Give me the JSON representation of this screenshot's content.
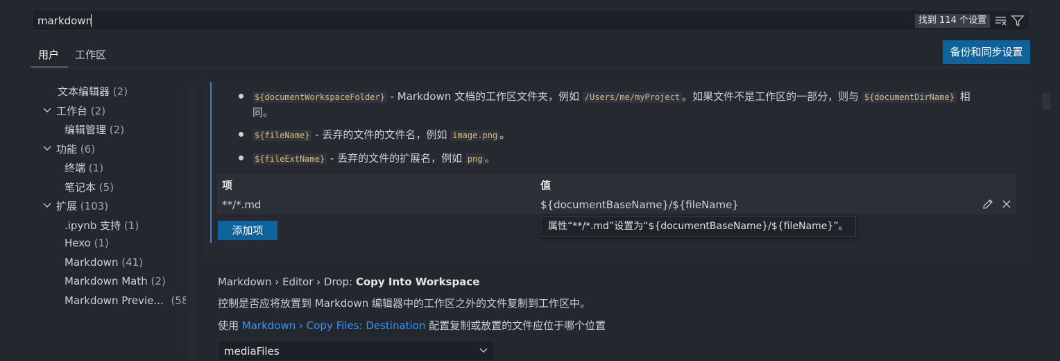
{
  "search": {
    "value": "markdown",
    "result_count": "找到 114 个设置"
  },
  "tabs": {
    "user": "用户",
    "workspace": "工作区"
  },
  "sync_button": "备份和同步设置",
  "sidebar": {
    "items": [
      {
        "label": "文本编辑器",
        "count": "(2)"
      },
      {
        "label": "工作台",
        "count": "(2)"
      },
      {
        "label": "编辑管理",
        "count": "(2)"
      },
      {
        "label": "功能",
        "count": "(6)"
      },
      {
        "label": "终端",
        "count": "(1)"
      },
      {
        "label": "笔记本",
        "count": "(5)"
      },
      {
        "label": "扩展",
        "count": "(103)"
      },
      {
        "label": ".ipynb 支持",
        "count": "(1)"
      },
      {
        "label": "Hexo",
        "count": "(1)"
      },
      {
        "label": "Markdown",
        "count": "(41)"
      },
      {
        "label": "Markdown Math",
        "count": "(2)"
      },
      {
        "label": "Markdown Previe...",
        "count": "(58)"
      }
    ]
  },
  "bullets": [
    {
      "code": "${documentWorkspaceFolder}",
      "text1": " - Markdown 文档的工作区文件夹，例如 ",
      "code2": "/Users/me/myProject",
      "text2": "。如果文件不是工作区的一部分，则与 ",
      "code3": "${documentDirName}",
      "text3": " 相",
      "text4": "同。"
    },
    {
      "code": "${fileName}",
      "text1": " - 丢弃的文件的文件名，例如 ",
      "code2": "image.png",
      "text2": "。"
    },
    {
      "code": "${fileExtName}",
      "text1": " - 丢弃的文件的扩展名，例如 ",
      "code2": "png",
      "text2": "。"
    }
  ],
  "table": {
    "header_item": "项",
    "header_value": "值",
    "row_item": "**/*.md",
    "row_value": "${documentBaseName}/${fileName}"
  },
  "add_item_button": "添加项",
  "tooltip": "属性“**/*.md”设置为“${documentBaseName}/${fileName}”。",
  "setting": {
    "title_prefix": "Markdown › Editor › Drop: ",
    "title_name": "Copy Into Workspace",
    "description": "控制是否应将放置到 Markdown 编辑器中的工作区之外的文件复制到工作区中。",
    "desc2_prefix": "使用 ",
    "desc2_link": "Markdown › Copy Files: Destination",
    "desc2_suffix": " 配置复制或放置的文件应位于哪个位置",
    "dropdown_value": "mediaFiles"
  },
  "colors": {
    "accent": "#0e639c",
    "link": "#3794ff",
    "focus": "#3b83c4"
  }
}
